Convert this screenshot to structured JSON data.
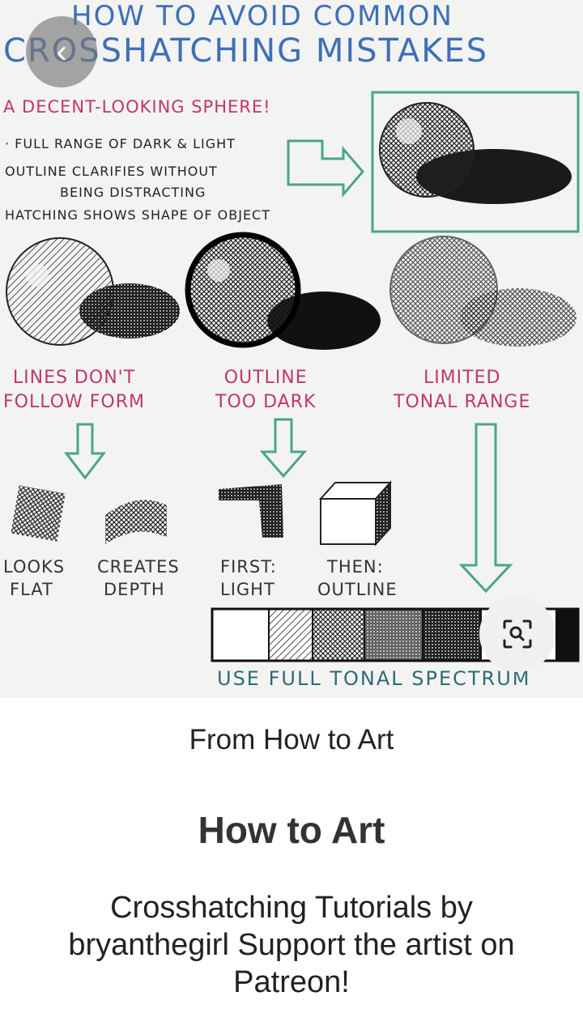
{
  "image": {
    "title_line1": "HOW TO AVOID COMMON",
    "title_line2": "CROSSHATCHING MISTAKES",
    "good_sphere_heading": "A DECENT-LOOKING SPHERE!",
    "good_points": [
      "· FULL RANGE OF DARK & LIGHT",
      "OUTLINE CLARIFIES WITHOUT",
      "BEING DISTRACTING",
      "HATCHING SHOWS SHAPE OF OBJECT"
    ],
    "mistakes": [
      {
        "line1": "LINES DON'T",
        "line2": "FOLLOW FORM"
      },
      {
        "line1": "OUTLINE",
        "line2": "TOO DARK"
      },
      {
        "line1": "LIMITED",
        "line2": "TONAL RANGE"
      }
    ],
    "tips": [
      {
        "line1": "LOOKS",
        "line2": "FLAT"
      },
      {
        "line1": "CREATES",
        "line2": "DEPTH"
      },
      {
        "line1": "FIRST:",
        "line2": "LIGHT"
      },
      {
        "line1": "THEN:",
        "line2": "OUTLINE"
      }
    ],
    "spectrum_label": "USE FULL TONAL SPECTRUM"
  },
  "icons": {
    "back": "chevron-left-icon",
    "visual_search": "lens-search-icon"
  },
  "colors": {
    "title_blue": "#3e6fb8",
    "label_pink": "#c2356f",
    "arrow_green": "#4aa58a"
  },
  "pin": {
    "source": "From How to Art",
    "board_title": "How to Art",
    "description": "Crosshatching Tutorials by bryanthegirl Support the artist on Patreon!"
  }
}
